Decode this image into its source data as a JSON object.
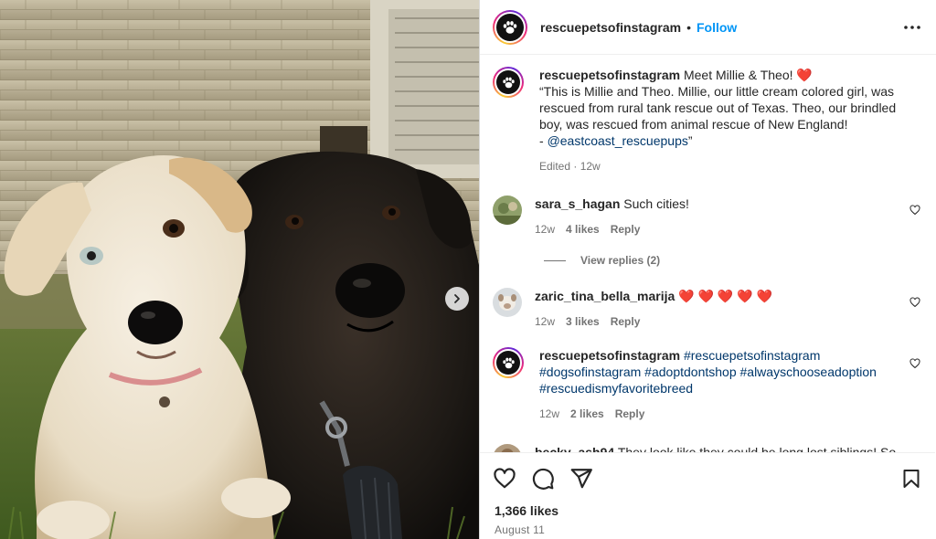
{
  "post": {
    "username": "rescuepetsofinstagram",
    "dot": "•",
    "follow_label": "Follow",
    "caption": {
      "lead": "Meet Millie & Theo! ❤️",
      "body": "“This is Millie and Theo. Millie, our little cream colored girl, was rescued from rural tank rescue out of Texas. Theo, our brindled boy, was rescued from animal rescue of New England!",
      "dash": "- ",
      "mention": "@eastcoast_rescuepups",
      "end_quote": "”",
      "meta": "Edited · 12w"
    },
    "likes": "1,366 likes",
    "date": "August 11"
  },
  "comments": [
    {
      "username": "sara_s_hagan",
      "text": "Such cities!",
      "age": "12w",
      "likes": "4 likes",
      "reply": "Reply",
      "view_replies": "View replies (2)"
    },
    {
      "username": "zaric_tina_bella_marija",
      "text": "❤️ ❤️ ❤️ ❤️ ❤️",
      "age": "12w",
      "likes": "3 likes",
      "reply": "Reply"
    },
    {
      "username": "rescuepetsofinstagram",
      "tags": "#rescuepetsofinstagram #dogsofinstagram #adoptdontshop #alwayschooseadoption #rescuedismyfavoritebreed",
      "age": "12w",
      "likes": "2 likes",
      "reply": "Reply"
    },
    {
      "username": "becky_ash94",
      "text": "They look like they could be long lost siblings! So"
    }
  ],
  "icons": {
    "more": "more-options-icon",
    "like": "heart-icon",
    "comment": "comment-icon",
    "share": "share-icon",
    "save": "bookmark-icon",
    "next": "chevron-right-icon",
    "avatar": "paw-icon"
  },
  "colors": {
    "accent": "#0095f6",
    "heart": "#ff3040",
    "hashtag": "#00376b",
    "muted": "#737373"
  }
}
